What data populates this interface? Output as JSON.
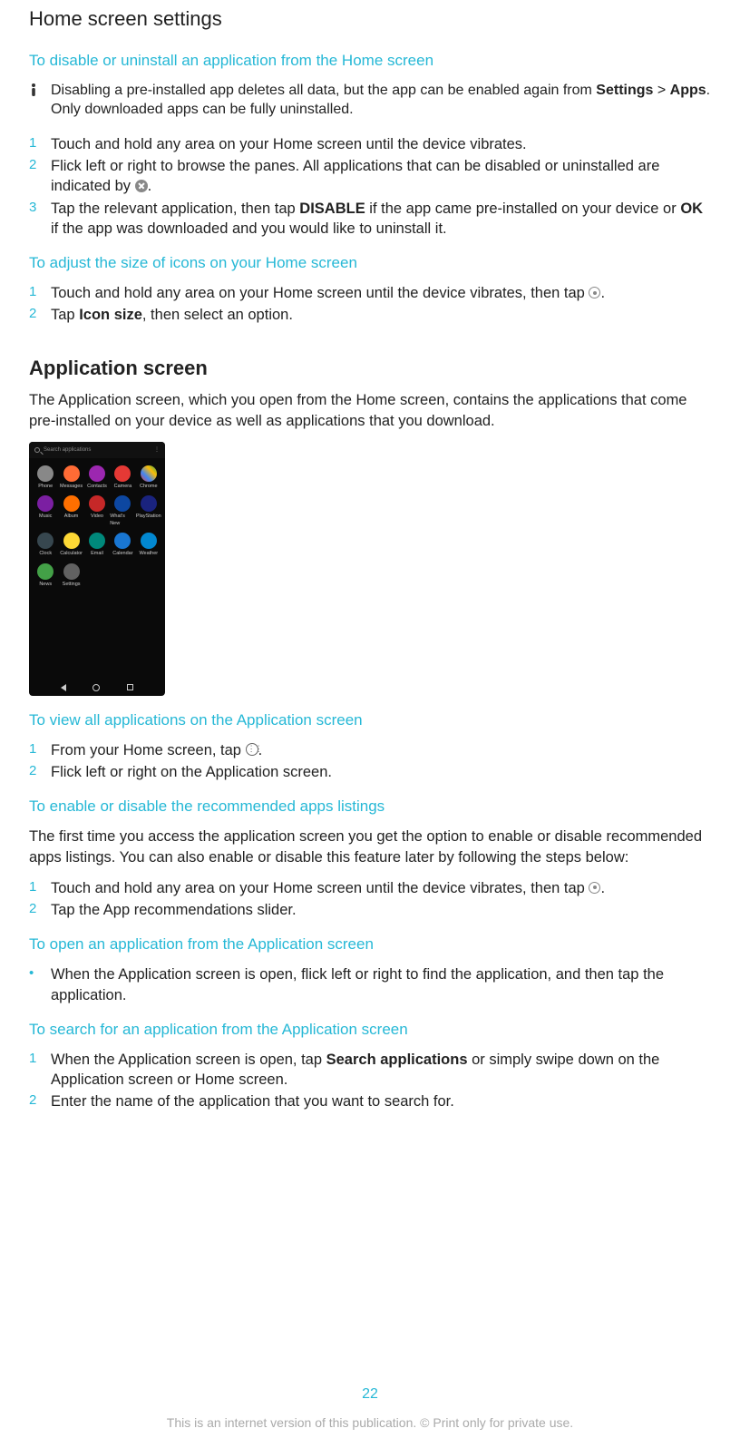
{
  "title": "Home screen settings",
  "sec1": {
    "heading": "To disable or uninstall an application from the Home screen",
    "note_pre": "Disabling a pre-installed app deletes all data, but the app can be enabled again from ",
    "note_b1": "Settings",
    "note_mid": " > ",
    "note_b2": "Apps",
    "note_post": ". Only downloaded apps can be fully uninstalled.",
    "steps": {
      "n1": "1",
      "s1": "Touch and hold any area on your Home screen until the device vibrates.",
      "n2": "2",
      "s2a": "Flick left or right to browse the panes. All applications that can be disabled or uninstalled are indicated by ",
      "s2b": ".",
      "n3": "3",
      "s3a": "Tap the relevant application, then tap ",
      "s3b": "DISABLE",
      "s3c": " if the app came pre-installed on your device or ",
      "s3d": "OK",
      "s3e": " if the app was downloaded and you would like to uninstall it."
    }
  },
  "sec2": {
    "heading": "To adjust the size of icons on your Home screen",
    "n1": "1",
    "s1a": "Touch and hold any area on your Home screen until the device vibrates, then tap ",
    "s1b": ".",
    "n2": "2",
    "s2a": "Tap ",
    "s2b": "Icon size",
    "s2c": ", then select an option."
  },
  "h2": "Application screen",
  "h2_para": "The Application screen, which you open from the Home screen, contains the applications that come pre-installed on your device as well as applications that you download.",
  "phone": {
    "search": "Search applications",
    "menu": "⋮",
    "apps": {
      "a1": "Phone",
      "a2": "Messages",
      "a3": "Contacts",
      "a4": "Camera",
      "a5": "Chrome",
      "a6": "Music",
      "a7": "Album",
      "a8": "Video",
      "a9": "What's New",
      "a10": "PlayStation",
      "a11": "Clock",
      "a12": "Calculator",
      "a13": "Email",
      "a14": "Calendar",
      "a15": "Weather",
      "a16": "News",
      "a17": "Settings"
    }
  },
  "sec3": {
    "heading": "To view all applications on the Application screen",
    "n1": "1",
    "s1a": "From your Home screen, tap ",
    "s1b": ".",
    "n2": "2",
    "s2": "Flick left or right on the Application screen."
  },
  "sec4": {
    "heading": "To enable or disable the recommended apps listings",
    "para": "The first time you access the application screen you get the option to enable or disable recommended apps listings. You can also enable or disable this feature later by following the steps below:",
    "n1": "1",
    "s1a": "Touch and hold any area on your Home screen until the device vibrates, then tap ",
    "s1b": ".",
    "n2": "2",
    "s2": "Tap the App recommendations slider."
  },
  "sec5": {
    "heading": "To open an application from the Application screen",
    "bullet": "•",
    "txt": "When the Application screen is open, flick left or right to find the application, and then tap the application."
  },
  "sec6": {
    "heading": "To search for an application from the Application screen",
    "n1": "1",
    "s1a": "When the Application screen is open, tap ",
    "s1b": "Search applications",
    "s1c": " or simply swipe down on the Application screen or Home screen.",
    "n2": "2",
    "s2": "Enter the name of the application that you want to search for."
  },
  "page_num": "22",
  "footer": "This is an internet version of this publication. © Print only for private use."
}
